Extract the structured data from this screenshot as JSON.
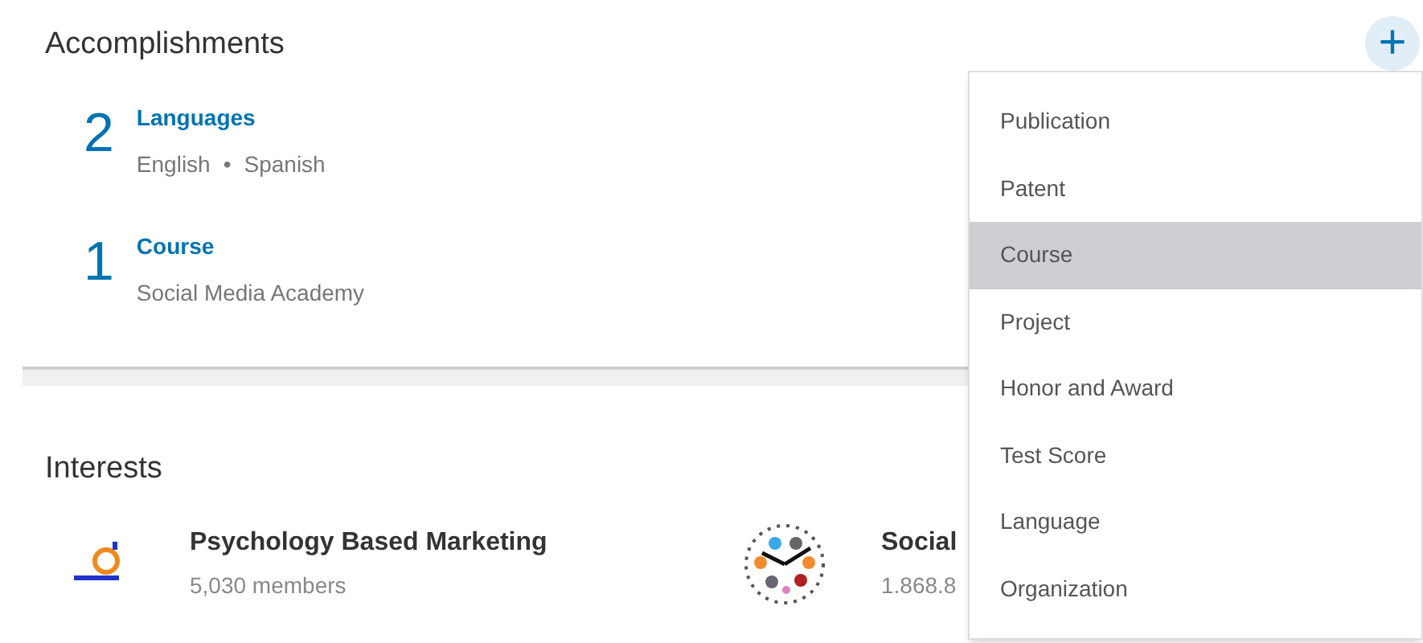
{
  "accomplishments": {
    "title": "Accomplishments",
    "items": [
      {
        "count": "2",
        "title": "Languages",
        "detail": [
          "English",
          "Spanish"
        ],
        "separator": "•"
      },
      {
        "count": "1",
        "title": "Course",
        "detail": [
          "Social Media Academy"
        ]
      }
    ]
  },
  "add_button": {
    "label": "+"
  },
  "menu": [
    {
      "label": "Publication",
      "selected": false
    },
    {
      "label": "Patent",
      "selected": false
    },
    {
      "label": "Course",
      "selected": true
    },
    {
      "label": "Project",
      "selected": false
    },
    {
      "label": "Honor and Award",
      "selected": false
    },
    {
      "label": "Test Score",
      "selected": false
    },
    {
      "label": "Language",
      "selected": false
    },
    {
      "label": "Organization",
      "selected": false
    }
  ],
  "interests": {
    "title": "Interests",
    "items": [
      {
        "name": "Psychology Based Marketing",
        "members": "5,030 members",
        "kind": "marketing"
      },
      {
        "name": "Social",
        "members": "1.868.8",
        "kind": "clock"
      }
    ]
  }
}
